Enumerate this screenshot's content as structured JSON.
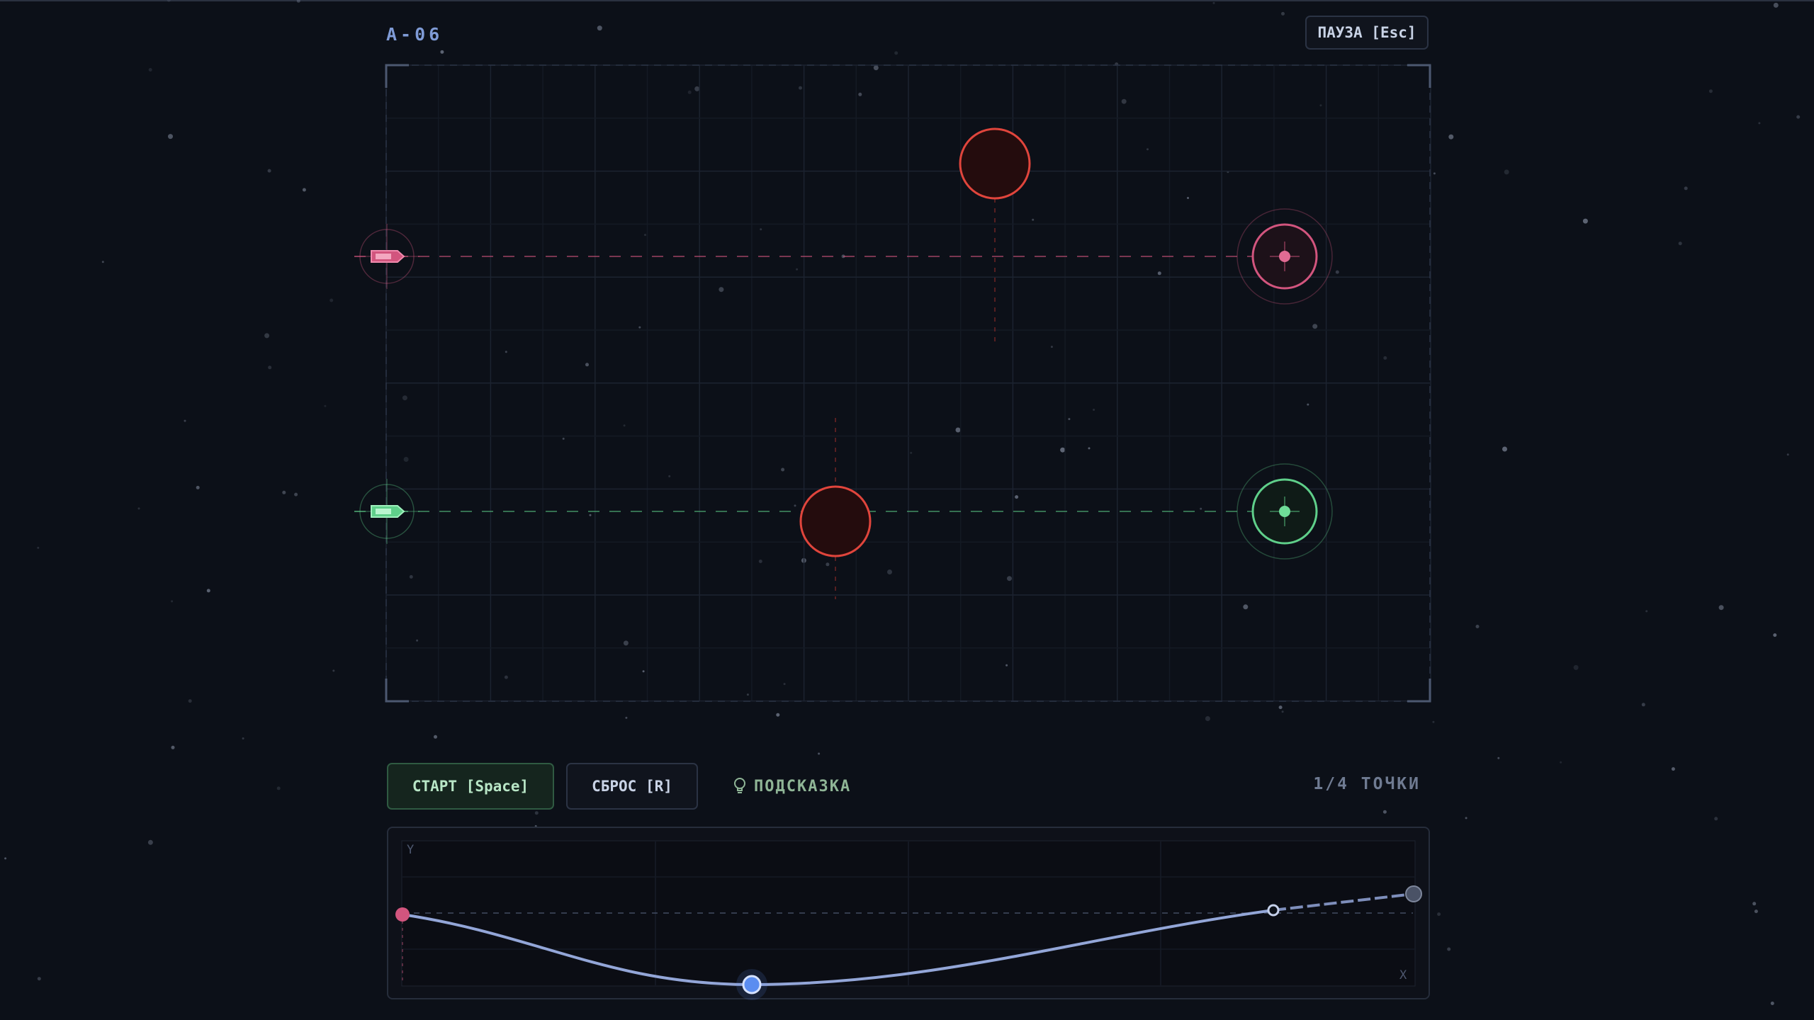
{
  "level": {
    "code": "A-06"
  },
  "header": {
    "pause_label": "ПАУЗА [Esc]"
  },
  "controls": {
    "start_label": "СТАРТ [Space]",
    "reset_label": "СБРОС [R]",
    "hint_label": "ПОДСКАЗКА",
    "points_label": "1/4 ТОЧКИ"
  },
  "graph": {
    "y_axis_label": "Y",
    "x_axis_label": "X"
  },
  "colors": {
    "pink": "#d2557e",
    "green": "#5fcf8a",
    "danger": "#e0453c",
    "curve": "#93a6d8",
    "accent_blue": "#5b8df0"
  },
  "field_objects": {
    "ships": [
      {
        "name": "pink-ship",
        "color": "pink"
      },
      {
        "name": "green-ship",
        "color": "green"
      }
    ],
    "targets": [
      {
        "name": "pink-target",
        "color": "pink"
      },
      {
        "name": "green-target",
        "color": "green"
      }
    ],
    "obstacles": [
      {
        "name": "red-obstacle-top"
      },
      {
        "name": "red-obstacle-bottom"
      }
    ]
  }
}
